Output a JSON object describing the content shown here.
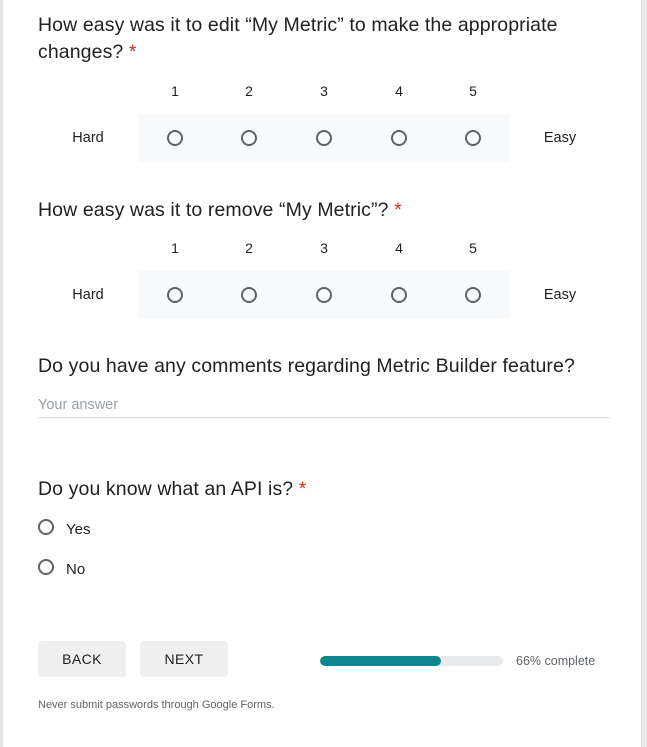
{
  "required_marker": "*",
  "questions": [
    {
      "title": "How easy was it to edit “My Metric” to make the appropriate changes?",
      "required": true,
      "scale": [
        "1",
        "2",
        "3",
        "4",
        "5"
      ],
      "low_label": "Hard",
      "high_label": "Easy",
      "selected": null
    },
    {
      "title": "How easy was it to remove “My Metric”?",
      "required": true,
      "scale": [
        "1",
        "2",
        "3",
        "4",
        "5"
      ],
      "low_label": "Hard",
      "high_label": "Easy",
      "selected": null
    },
    {
      "title": "Do you have any comments regarding Metric Builder feature?",
      "required": false,
      "placeholder": "Your answer",
      "value": ""
    },
    {
      "title": "Do you know what an API is?",
      "required": true,
      "options": [
        "Yes",
        "No"
      ],
      "selected": null
    }
  ],
  "nav": {
    "back_label": "BACK",
    "next_label": "NEXT"
  },
  "progress": {
    "percent": 66,
    "label": "66% complete"
  },
  "footer": {
    "note": "Never submit passwords through Google Forms."
  },
  "colors": {
    "required": "#d93025",
    "progress_fill": "#0f858e",
    "radio_border": "#5f6368"
  }
}
